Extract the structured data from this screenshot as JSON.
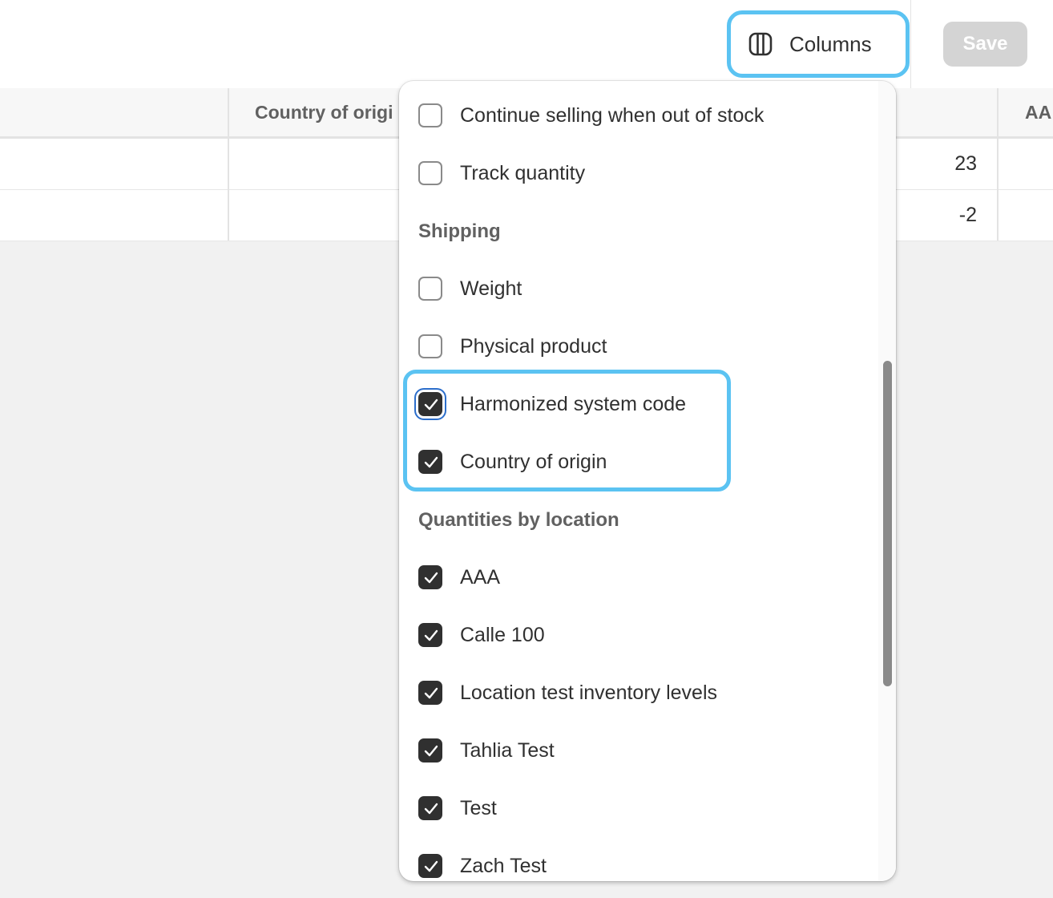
{
  "toolbar": {
    "columns_label": "Columns",
    "columns_icon": "columns-icon",
    "save_label": "Save"
  },
  "table": {
    "headers": [
      "Country of origi",
      "AA"
    ],
    "rows": [
      {
        "quantity": "23"
      },
      {
        "quantity": "-2"
      }
    ]
  },
  "menu": {
    "options_top": [
      {
        "label": "Continue selling when out of stock",
        "checked": false
      },
      {
        "label": "Track quantity",
        "checked": false
      }
    ],
    "shipping": {
      "heading": "Shipping",
      "options": [
        {
          "label": "Weight",
          "checked": false
        },
        {
          "label": "Physical product",
          "checked": false
        },
        {
          "label": "Harmonized system code",
          "checked": true
        },
        {
          "label": "Country of origin",
          "checked": true
        }
      ]
    },
    "quantities": {
      "heading": "Quantities by location",
      "options": [
        {
          "label": "AAA",
          "checked": true
        },
        {
          "label": "Calle 100",
          "checked": true
        },
        {
          "label": "Location test inventory levels",
          "checked": true
        },
        {
          "label": "Tahlia Test",
          "checked": true
        },
        {
          "label": "Test",
          "checked": true
        },
        {
          "label": "Zach Test",
          "checked": true
        }
      ]
    }
  },
  "colors": {
    "highlight": "#5bc3f2",
    "checkbox_checked": "#303030",
    "focus_ring": "#2c6ecb",
    "save_disabled": "#d4d4d4"
  }
}
